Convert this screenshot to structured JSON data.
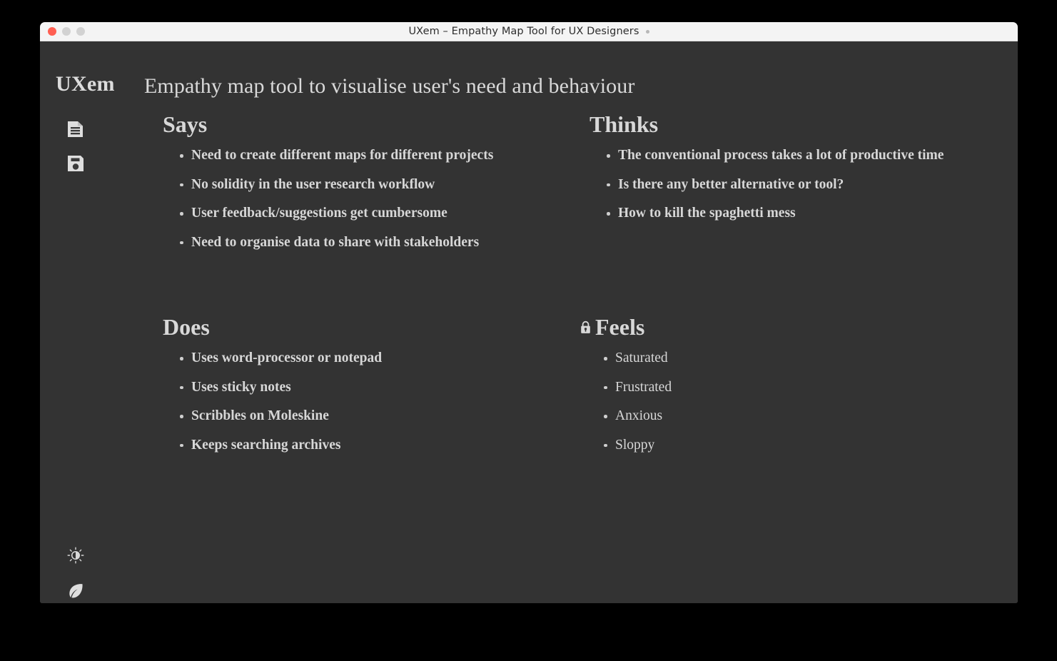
{
  "window": {
    "title": "UXem – Empathy Map Tool for UX Designers",
    "modified_dot": "",
    "traffic_lights": {
      "close": "close-button",
      "minimize": "minimize-button",
      "maximize": "maximize-button"
    },
    "colors": {
      "desktop_background": "#000000",
      "titlebar": "#f4f4f4",
      "app_background": "#333333",
      "text": "#d8d8d8",
      "close_dot": "#ff5f52",
      "inactive_dot": "#d2d2d2"
    }
  },
  "sidebar": {
    "brand": "UXem",
    "tools": [
      {
        "name": "new-map-icon",
        "label": "New map"
      },
      {
        "name": "save-map-icon",
        "label": "Save map"
      }
    ],
    "footer_tools": [
      {
        "name": "brightness-icon",
        "label": "Toggle theme"
      },
      {
        "name": "leaf-icon",
        "label": "Eco mode"
      }
    ]
  },
  "header": {
    "page_title": "Empathy map tool to visualise user's need and behaviour"
  },
  "map": {
    "quadrants": [
      {
        "id": "says",
        "heading": "Says",
        "locked": false,
        "emphasis": "bold",
        "items": [
          "Need to create different maps for different projects",
          "No solidity in the user research workflow",
          "User feedback/suggestions get cumbersome",
          "Need to organise data to share with stakeholders"
        ]
      },
      {
        "id": "thinks",
        "heading": "Thinks",
        "locked": false,
        "emphasis": "bold",
        "items": [
          "The conventional process takes a lot of productive time",
          "Is there any better alternative or tool?",
          "How to kill the spaghetti mess"
        ]
      },
      {
        "id": "does",
        "heading": "Does",
        "locked": false,
        "emphasis": "bold",
        "items": [
          "Uses word-processor or notepad",
          "Uses sticky notes",
          "Scribbles on Moleskine",
          "Keeps searching archives"
        ]
      },
      {
        "id": "feels",
        "heading": "Feels",
        "locked": true,
        "lock_icon": "lock-icon",
        "emphasis": "light",
        "items": [
          "Saturated",
          "Frustrated",
          "Anxious",
          "Sloppy"
        ]
      }
    ]
  }
}
